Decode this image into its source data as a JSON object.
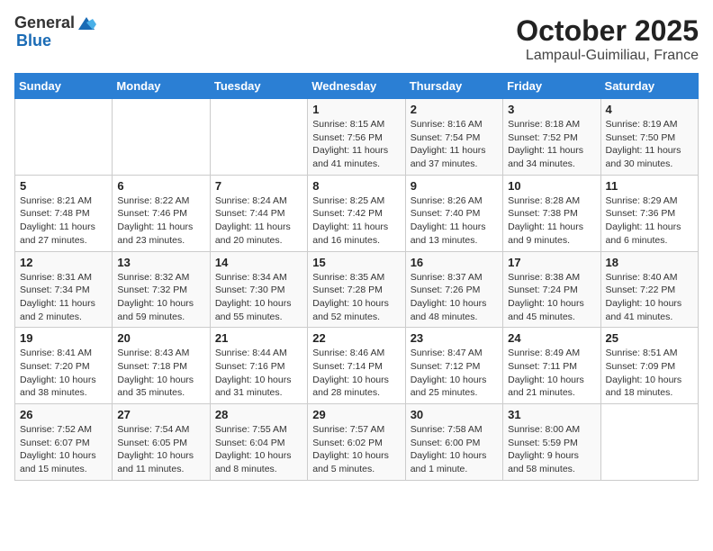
{
  "header": {
    "logo_general": "General",
    "logo_blue": "Blue",
    "title": "October 2025",
    "subtitle": "Lampaul-Guimiliau, France"
  },
  "weekdays": [
    "Sunday",
    "Monday",
    "Tuesday",
    "Wednesday",
    "Thursday",
    "Friday",
    "Saturday"
  ],
  "weeks": [
    [
      {
        "day": "",
        "sunrise": "",
        "sunset": "",
        "daylight": ""
      },
      {
        "day": "",
        "sunrise": "",
        "sunset": "",
        "daylight": ""
      },
      {
        "day": "",
        "sunrise": "",
        "sunset": "",
        "daylight": ""
      },
      {
        "day": "1",
        "sunrise": "Sunrise: 8:15 AM",
        "sunset": "Sunset: 7:56 PM",
        "daylight": "Daylight: 11 hours and 41 minutes."
      },
      {
        "day": "2",
        "sunrise": "Sunrise: 8:16 AM",
        "sunset": "Sunset: 7:54 PM",
        "daylight": "Daylight: 11 hours and 37 minutes."
      },
      {
        "day": "3",
        "sunrise": "Sunrise: 8:18 AM",
        "sunset": "Sunset: 7:52 PM",
        "daylight": "Daylight: 11 hours and 34 minutes."
      },
      {
        "day": "4",
        "sunrise": "Sunrise: 8:19 AM",
        "sunset": "Sunset: 7:50 PM",
        "daylight": "Daylight: 11 hours and 30 minutes."
      }
    ],
    [
      {
        "day": "5",
        "sunrise": "Sunrise: 8:21 AM",
        "sunset": "Sunset: 7:48 PM",
        "daylight": "Daylight: 11 hours and 27 minutes."
      },
      {
        "day": "6",
        "sunrise": "Sunrise: 8:22 AM",
        "sunset": "Sunset: 7:46 PM",
        "daylight": "Daylight: 11 hours and 23 minutes."
      },
      {
        "day": "7",
        "sunrise": "Sunrise: 8:24 AM",
        "sunset": "Sunset: 7:44 PM",
        "daylight": "Daylight: 11 hours and 20 minutes."
      },
      {
        "day": "8",
        "sunrise": "Sunrise: 8:25 AM",
        "sunset": "Sunset: 7:42 PM",
        "daylight": "Daylight: 11 hours and 16 minutes."
      },
      {
        "day": "9",
        "sunrise": "Sunrise: 8:26 AM",
        "sunset": "Sunset: 7:40 PM",
        "daylight": "Daylight: 11 hours and 13 minutes."
      },
      {
        "day": "10",
        "sunrise": "Sunrise: 8:28 AM",
        "sunset": "Sunset: 7:38 PM",
        "daylight": "Daylight: 11 hours and 9 minutes."
      },
      {
        "day": "11",
        "sunrise": "Sunrise: 8:29 AM",
        "sunset": "Sunset: 7:36 PM",
        "daylight": "Daylight: 11 hours and 6 minutes."
      }
    ],
    [
      {
        "day": "12",
        "sunrise": "Sunrise: 8:31 AM",
        "sunset": "Sunset: 7:34 PM",
        "daylight": "Daylight: 11 hours and 2 minutes."
      },
      {
        "day": "13",
        "sunrise": "Sunrise: 8:32 AM",
        "sunset": "Sunset: 7:32 PM",
        "daylight": "Daylight: 10 hours and 59 minutes."
      },
      {
        "day": "14",
        "sunrise": "Sunrise: 8:34 AM",
        "sunset": "Sunset: 7:30 PM",
        "daylight": "Daylight: 10 hours and 55 minutes."
      },
      {
        "day": "15",
        "sunrise": "Sunrise: 8:35 AM",
        "sunset": "Sunset: 7:28 PM",
        "daylight": "Daylight: 10 hours and 52 minutes."
      },
      {
        "day": "16",
        "sunrise": "Sunrise: 8:37 AM",
        "sunset": "Sunset: 7:26 PM",
        "daylight": "Daylight: 10 hours and 48 minutes."
      },
      {
        "day": "17",
        "sunrise": "Sunrise: 8:38 AM",
        "sunset": "Sunset: 7:24 PM",
        "daylight": "Daylight: 10 hours and 45 minutes."
      },
      {
        "day": "18",
        "sunrise": "Sunrise: 8:40 AM",
        "sunset": "Sunset: 7:22 PM",
        "daylight": "Daylight: 10 hours and 41 minutes."
      }
    ],
    [
      {
        "day": "19",
        "sunrise": "Sunrise: 8:41 AM",
        "sunset": "Sunset: 7:20 PM",
        "daylight": "Daylight: 10 hours and 38 minutes."
      },
      {
        "day": "20",
        "sunrise": "Sunrise: 8:43 AM",
        "sunset": "Sunset: 7:18 PM",
        "daylight": "Daylight: 10 hours and 35 minutes."
      },
      {
        "day": "21",
        "sunrise": "Sunrise: 8:44 AM",
        "sunset": "Sunset: 7:16 PM",
        "daylight": "Daylight: 10 hours and 31 minutes."
      },
      {
        "day": "22",
        "sunrise": "Sunrise: 8:46 AM",
        "sunset": "Sunset: 7:14 PM",
        "daylight": "Daylight: 10 hours and 28 minutes."
      },
      {
        "day": "23",
        "sunrise": "Sunrise: 8:47 AM",
        "sunset": "Sunset: 7:12 PM",
        "daylight": "Daylight: 10 hours and 25 minutes."
      },
      {
        "day": "24",
        "sunrise": "Sunrise: 8:49 AM",
        "sunset": "Sunset: 7:11 PM",
        "daylight": "Daylight: 10 hours and 21 minutes."
      },
      {
        "day": "25",
        "sunrise": "Sunrise: 8:51 AM",
        "sunset": "Sunset: 7:09 PM",
        "daylight": "Daylight: 10 hours and 18 minutes."
      }
    ],
    [
      {
        "day": "26",
        "sunrise": "Sunrise: 7:52 AM",
        "sunset": "Sunset: 6:07 PM",
        "daylight": "Daylight: 10 hours and 15 minutes."
      },
      {
        "day": "27",
        "sunrise": "Sunrise: 7:54 AM",
        "sunset": "Sunset: 6:05 PM",
        "daylight": "Daylight: 10 hours and 11 minutes."
      },
      {
        "day": "28",
        "sunrise": "Sunrise: 7:55 AM",
        "sunset": "Sunset: 6:04 PM",
        "daylight": "Daylight: 10 hours and 8 minutes."
      },
      {
        "day": "29",
        "sunrise": "Sunrise: 7:57 AM",
        "sunset": "Sunset: 6:02 PM",
        "daylight": "Daylight: 10 hours and 5 minutes."
      },
      {
        "day": "30",
        "sunrise": "Sunrise: 7:58 AM",
        "sunset": "Sunset: 6:00 PM",
        "daylight": "Daylight: 10 hours and 1 minute."
      },
      {
        "day": "31",
        "sunrise": "Sunrise: 8:00 AM",
        "sunset": "Sunset: 5:59 PM",
        "daylight": "Daylight: 9 hours and 58 minutes."
      },
      {
        "day": "",
        "sunrise": "",
        "sunset": "",
        "daylight": ""
      }
    ]
  ]
}
